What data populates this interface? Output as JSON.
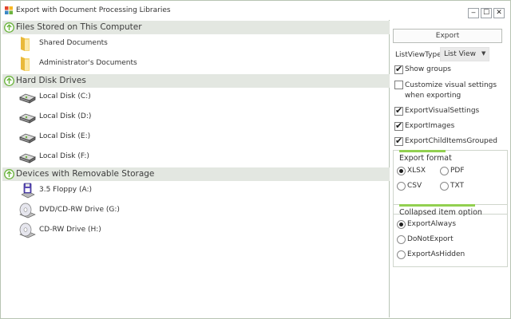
{
  "window": {
    "title": "Export with Document Processing Libraries",
    "controls": {
      "minimize": "‒",
      "maximize": "☐",
      "close": "✕"
    }
  },
  "listview": {
    "groups": [
      {
        "label": "Files Stored on This Computer",
        "items": [
          {
            "label": "Shared Documents",
            "icon": "folder-icon"
          },
          {
            "label": "Administrator's Documents",
            "icon": "folder-icon"
          }
        ]
      },
      {
        "label": "Hard Disk Drives",
        "items": [
          {
            "label": "Local Disk (C:)",
            "icon": "hard-disk-icon"
          },
          {
            "label": "Local Disk (D:)",
            "icon": "hard-disk-icon"
          },
          {
            "label": "Local Disk (E:)",
            "icon": "hard-disk-icon"
          },
          {
            "label": "Local Disk (F:)",
            "icon": "hard-disk-icon"
          }
        ]
      },
      {
        "label": "Devices with Removable Storage",
        "items": [
          {
            "label": "3.5 Floppy (A:)",
            "icon": "floppy-disk-icon"
          },
          {
            "label": "DVD/CD-RW Drive (G:)",
            "icon": "dvd-drive-icon"
          },
          {
            "label": "CD-RW Drive (H:)",
            "icon": "cd-drive-icon"
          }
        ]
      }
    ]
  },
  "panel": {
    "export_label": "Export",
    "listview_type_label": "ListViewType:",
    "listview_type_value": "List View",
    "checkboxes": [
      {
        "label": "Show groups",
        "checked": true
      },
      {
        "label": "Customize visual settings when exporting",
        "checked": false
      },
      {
        "label": "ExportVisualSettings",
        "checked": true
      },
      {
        "label": "ExportImages",
        "checked": true
      },
      {
        "label": "ExportChildItemsGrouped",
        "checked": true
      }
    ],
    "export_format": {
      "title": "Export format",
      "options": [
        {
          "label": "XLSX",
          "selected": true
        },
        {
          "label": "PDF",
          "selected": false
        },
        {
          "label": "CSV",
          "selected": false
        },
        {
          "label": "TXT",
          "selected": false
        }
      ]
    },
    "collapsed_option": {
      "title": "Collapsed item option",
      "options": [
        {
          "label": "ExportAlways",
          "selected": true
        },
        {
          "label": "DoNotExport",
          "selected": false
        },
        {
          "label": "ExportAsHidden",
          "selected": false
        }
      ]
    }
  },
  "colors": {
    "accent_green": "#92d050",
    "group_header_bg": "#e3e7e1",
    "expand_icon_green": "#69b33b"
  }
}
